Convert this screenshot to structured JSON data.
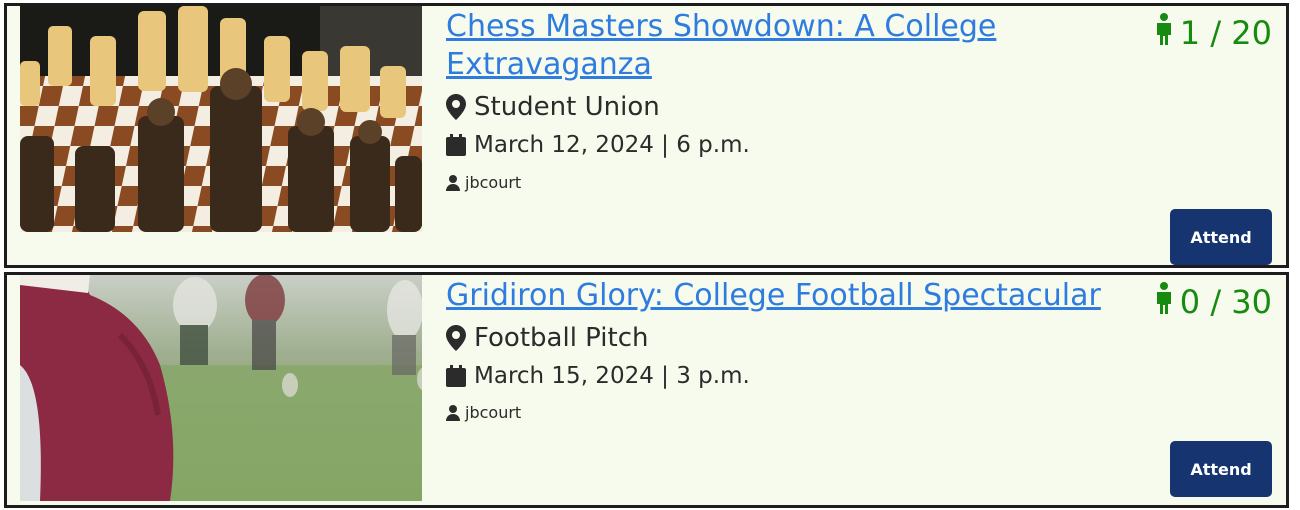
{
  "events": [
    {
      "title": "Chess Masters Showdown: A College Extravaganza",
      "location": "Student Union",
      "datetime": "March 12, 2024 | 6 p.m.",
      "organizer": "jbcourt",
      "capacity": "1 / 20",
      "attend_label": "Attend",
      "image": "chess-pieces-photo"
    },
    {
      "title": "Gridiron Glory: College Football Spectacular",
      "location": "Football Pitch",
      "datetime": "March 15, 2024 | 3 p.m.",
      "organizer": "jbcourt",
      "capacity": "0 / 30",
      "attend_label": "Attend",
      "image": "football-players-photo"
    }
  ],
  "colors": {
    "link": "#2f7ce0",
    "capacity": "#178a10",
    "button": "#163570",
    "card_background": "#f7fbed",
    "card_border": "#1c1c1c"
  }
}
